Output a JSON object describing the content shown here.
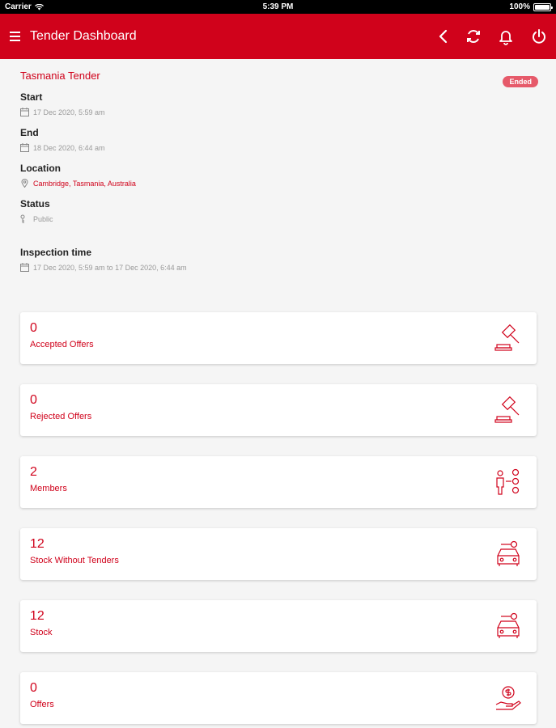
{
  "statusbar": {
    "carrier": "Carrier",
    "time": "5:39 PM",
    "battery": "100%"
  },
  "header": {
    "title": "Tender Dashboard"
  },
  "tender": {
    "name": "Tasmania Tender",
    "status": "Ended",
    "start_label": "Start",
    "start_value": "17 Dec 2020, 5:59 am",
    "end_label": "End",
    "end_value": "18 Dec 2020, 6:44 am",
    "location_label": "Location",
    "location_value": "Cambridge, Tasmania, Australia",
    "status_label": "Status",
    "status_value": "Public",
    "inspection_label": "Inspection time",
    "inspection_value": "17 Dec 2020, 5:59 am to 17 Dec 2020, 6:44 am"
  },
  "cards": [
    {
      "count": "0",
      "label": "Accepted Offers",
      "icon": "gavel-icon"
    },
    {
      "count": "0",
      "label": "Rejected Offers",
      "icon": "gavel-icon"
    },
    {
      "count": "2",
      "label": "Members",
      "icon": "members-icon"
    },
    {
      "count": "12",
      "label": "Stock Without Tenders",
      "icon": "car-icon"
    },
    {
      "count": "12",
      "label": "Stock",
      "icon": "car-icon"
    },
    {
      "count": "0",
      "label": "Offers",
      "icon": "money-hand-icon"
    }
  ],
  "colors": {
    "brand": "#d0021b",
    "badge": "#e65a6a",
    "background": "#f5f5f5"
  }
}
